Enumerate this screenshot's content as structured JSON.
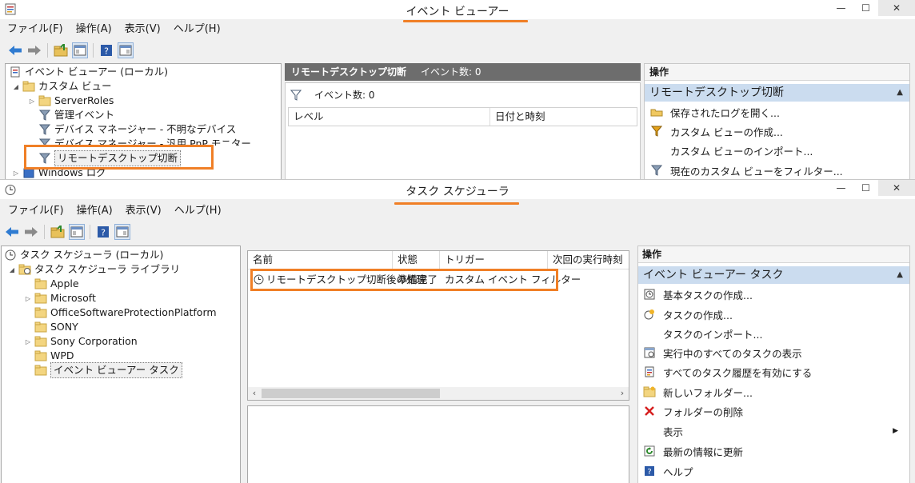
{
  "event_viewer": {
    "title": "イベント ビューアー",
    "menu": [
      "ファイル(F)",
      "操作(A)",
      "表示(V)",
      "ヘルプ(H)"
    ],
    "tree": {
      "root": "イベント ビューアー (ローカル)",
      "custom_views": "カスタム ビュー",
      "items": [
        "ServerRoles",
        "管理イベント",
        "デバイス マネージャー - 不明なデバイス",
        "デバイス マネージャー - 汎用 PnP モニター",
        "リモートデスクトップ切断"
      ],
      "windows_logs": "Windows ログ"
    },
    "center": {
      "header_title": "リモートデスクトップ切断",
      "header_count": "イベント数: 0",
      "filter_count": "イベント数: 0",
      "columns": [
        "レベル",
        "日付と時刻"
      ]
    },
    "actions": {
      "header": "操作",
      "section": "リモートデスクトップ切断",
      "items": [
        "保存されたログを開く...",
        "カスタム ビューの作成...",
        "カスタム ビューのインポート...",
        "現在のカスタム ビューをフィルター..."
      ]
    }
  },
  "task_scheduler": {
    "title": "タスク スケジューラ",
    "menu": [
      "ファイル(F)",
      "操作(A)",
      "表示(V)",
      "ヘルプ(H)"
    ],
    "tree": {
      "root": "タスク スケジューラ (ローカル)",
      "library": "タスク スケジューラ ライブラリ",
      "folders": [
        "Apple",
        "Microsoft",
        "OfficeSoftwareProtectionPlatform",
        "SONY",
        "Sony Corporation",
        "WPD",
        "イベント ビューアー タスク"
      ]
    },
    "task_list": {
      "columns": [
        "名前",
        "状態",
        "トリガー",
        "次回の実行時刻"
      ],
      "rows": [
        {
          "name": "リモートデスクトップ切断後の処理",
          "status": "準備完了",
          "trigger": "カスタム イベント フィルター",
          "next_run": ""
        }
      ]
    },
    "actions": {
      "header": "操作",
      "section": "イベント ビューアー タスク",
      "items": [
        "基本タスクの作成...",
        "タスクの作成...",
        "タスクのインポート...",
        "実行中のすべてのタスクの表示",
        "すべてのタスク履歴を有効にする",
        "新しいフォルダー...",
        "フォルダーの削除",
        "表示",
        "最新の情報に更新",
        "ヘルプ"
      ]
    }
  },
  "colors": {
    "highlight": "#f07f26",
    "actions_section_bg": "#cbdcef",
    "center_header_bg": "#6d6d6d"
  }
}
